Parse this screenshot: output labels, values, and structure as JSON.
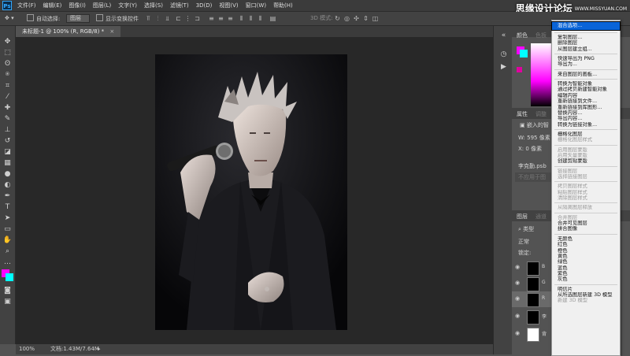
{
  "menubar": {
    "logo": "Ps",
    "items": [
      "文件(F)",
      "编辑(E)",
      "图像(I)",
      "图层(L)",
      "文字(Y)",
      "选择(S)",
      "滤镜(T)",
      "3D(D)",
      "视图(V)",
      "窗口(W)",
      "帮助(H)"
    ]
  },
  "watermark": {
    "title": "思缘设计论坛",
    "url": "WWW.MISSYUAN.COM"
  },
  "options": {
    "auto_select_label": "自动选择:",
    "auto_select_value": "图层",
    "show_transform_label": "显示变换控件",
    "mode_3d_label": "3D 模式:"
  },
  "document": {
    "tab_title": "未标题-1 @ 100% (R, RGB/8) *",
    "zoom": "100%",
    "doc_size": "文档:1.43M/7.64M"
  },
  "panels": {
    "color_tab": "颜色",
    "swatches_tab": "色板",
    "properties_tab": "属性",
    "adjust_tab": "调整",
    "embedded_label": "嵌入的智",
    "w_label": "W:",
    "w_value": "595 像素",
    "x_label": "X:",
    "x_value": "0 像素",
    "file_name": "李克勤.psb",
    "not_in_comp": "不应用于图",
    "layers_tab": "图层",
    "channels_tab": "通道",
    "kind_filter": "类型",
    "blend_mode": "正常",
    "lock_label": "锁定:",
    "layer_names": [
      "B",
      "G",
      "R",
      "李",
      "背"
    ]
  },
  "context_menu": {
    "items": [
      {
        "label": "混合选项...",
        "enabled": true,
        "highlighted": true
      },
      {
        "sep": true
      },
      {
        "label": "复制图层...",
        "enabled": true
      },
      {
        "label": "删除图层",
        "enabled": true
      },
      {
        "label": "从图层建立组...",
        "enabled": true
      },
      {
        "sep": true
      },
      {
        "label": "快速导出为 PNG",
        "enabled": true
      },
      {
        "label": "导出为...",
        "enabled": true
      },
      {
        "sep": true
      },
      {
        "label": "来自图层的画板...",
        "enabled": true
      },
      {
        "sep": true
      },
      {
        "label": "转换为智能对象",
        "enabled": true
      },
      {
        "label": "通过拷贝新建智能对象",
        "enabled": true
      },
      {
        "label": "编辑内容",
        "enabled": true
      },
      {
        "label": "重新链接到文件...",
        "enabled": true
      },
      {
        "label": "重新链接到库图形...",
        "enabled": true
      },
      {
        "label": "替换内容...",
        "enabled": true
      },
      {
        "label": "导出内容...",
        "enabled": true
      },
      {
        "label": "转换为链接对象...",
        "enabled": true
      },
      {
        "sep": true
      },
      {
        "label": "栅格化图层",
        "enabled": true
      },
      {
        "label": "栅格化图层样式",
        "enabled": false
      },
      {
        "sep": true
      },
      {
        "label": "启用图层蒙版",
        "enabled": false
      },
      {
        "label": "启用矢量蒙版",
        "enabled": false
      },
      {
        "label": "创建剪贴蒙版",
        "enabled": true
      },
      {
        "sep": true
      },
      {
        "label": "链接图层",
        "enabled": false
      },
      {
        "label": "选择链接图层",
        "enabled": false
      },
      {
        "sep": true
      },
      {
        "label": "拷贝图层样式",
        "enabled": false
      },
      {
        "label": "粘贴图层样式",
        "enabled": false
      },
      {
        "label": "清除图层样式",
        "enabled": false
      },
      {
        "sep": true
      },
      {
        "label": "从隔离图层释放",
        "enabled": false
      },
      {
        "sep": true
      },
      {
        "label": "合并图层",
        "enabled": false
      },
      {
        "label": "合并可见图层",
        "enabled": true
      },
      {
        "label": "拼合图像",
        "enabled": true
      },
      {
        "sep": true
      },
      {
        "label": "无颜色",
        "enabled": true
      },
      {
        "label": "红色",
        "enabled": true
      },
      {
        "label": "橙色",
        "enabled": true
      },
      {
        "label": "黄色",
        "enabled": true
      },
      {
        "label": "绿色",
        "enabled": true
      },
      {
        "label": "蓝色",
        "enabled": true
      },
      {
        "label": "紫色",
        "enabled": true
      },
      {
        "label": "灰色",
        "enabled": true
      },
      {
        "sep": true
      },
      {
        "label": "明信片",
        "enabled": true
      },
      {
        "label": "从所选图层新建 3D 模型",
        "enabled": true
      },
      {
        "label": "新建 3D 模型",
        "enabled": false
      }
    ]
  },
  "colors": {
    "foreground": "#ff00ff",
    "background": "#00ffff",
    "menu_highlight": "#0a64d8"
  }
}
